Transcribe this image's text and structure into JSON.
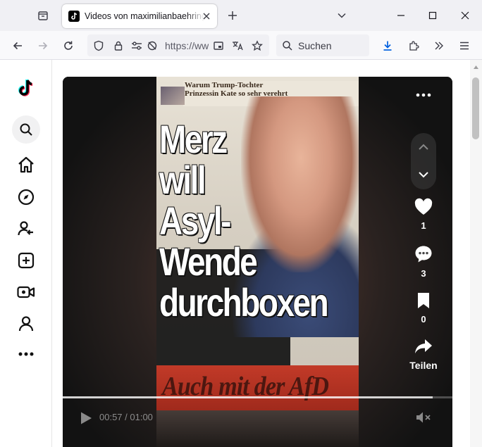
{
  "browser": {
    "tab_title": "Videos von maximilianbaehring",
    "url_display": "https://ww",
    "search_placeholder": "Suchen",
    "icons": [
      "tab-list-icon",
      "tiktok-favicon",
      "close-icon",
      "plus-icon",
      "chevron-down-icon",
      "minimize-icon",
      "maximize-icon",
      "close-window-icon",
      "back-icon",
      "forward-icon",
      "reload-icon",
      "shield-icon",
      "lock-icon",
      "permissions-icon",
      "tracking-off-icon",
      "reader-view-icon",
      "translate-icon",
      "star-icon",
      "search-icon",
      "download-icon",
      "extensions-icon",
      "overflow-chevrons-icon",
      "menu-icon"
    ]
  },
  "sidebar": {
    "items": [
      "tiktok-logo",
      "search",
      "home",
      "explore",
      "following",
      "upload",
      "live",
      "profile",
      "more"
    ]
  },
  "video": {
    "newspaper": {
      "small_headline_line1": "Warum Trump-Tochter",
      "small_headline_line2": "Prinzessin Kate so sehr verehrt",
      "headline_lines": [
        "Merz",
        "will",
        "Asyl-",
        "Wende",
        "durchboxen"
      ],
      "subline": "Auch mit der AfD"
    },
    "likes": "1",
    "comments": "3",
    "saves": "0",
    "share_label": "Teilen",
    "time_display": "00:57 / 01:00",
    "progress_fraction": 0.95
  },
  "colors": {
    "accent_blue": "#0060df",
    "player_bg": "#141414"
  }
}
